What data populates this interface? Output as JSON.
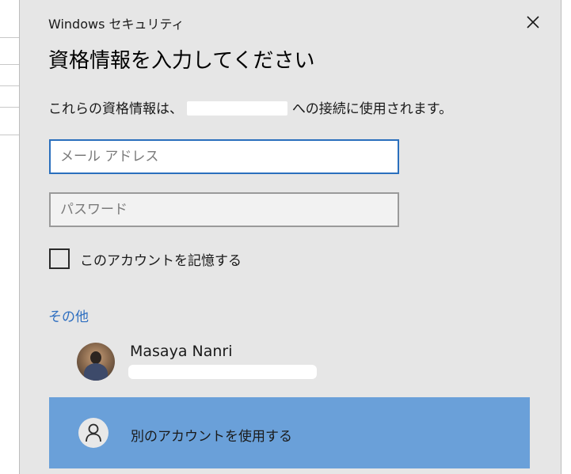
{
  "dialog": {
    "app_title": "Windows セキュリティ",
    "heading": "資格情報を入力してください",
    "description_before": "これらの資格情報は、",
    "description_after": "への接続に使用されます。"
  },
  "form": {
    "email_placeholder": "メール アドレス",
    "password_placeholder": "パスワード",
    "remember_label": "このアカウントを記憶する",
    "remember_checked": false
  },
  "more_choices": {
    "label": "その他",
    "account": {
      "name": "Masaya Nanri"
    },
    "other_account_label": "別のアカウントを使用する"
  },
  "colors": {
    "dialog_bg": "#e6e6e6",
    "accent": "#2a6fbd",
    "link": "#2f6fc0",
    "selected_bg": "#6aa0d9"
  },
  "icons": {
    "close": "close-icon",
    "other_account": "person-icon"
  }
}
